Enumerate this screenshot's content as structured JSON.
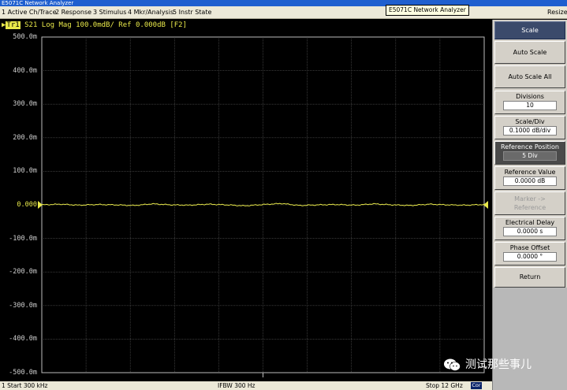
{
  "window": {
    "title": "E5071C Network Analyzer",
    "tooltip": "E5071C Network Analyzer",
    "resize_label": "Resize"
  },
  "menu": {
    "items": [
      "1 Active Ch/Trace",
      "2 Response",
      "3 Stimulus",
      "4 Mkr/Analysis",
      "5 Instr State"
    ]
  },
  "trace": {
    "id": "Tr1",
    "header": " S21 Log Mag 100.0mdB/ Ref 0.000dB [F2]",
    "color": "#e8e84a"
  },
  "axis": {
    "y_labels": [
      "500.0m",
      "400.0m",
      "300.0m",
      "200.0m",
      "100.0m",
      "0.000",
      "-100.0m",
      "-200.0m",
      "-300.0m",
      "-400.0m",
      "-500.0m"
    ],
    "divisions": 10,
    "ref_label": "0.000"
  },
  "chart_data": {
    "type": "line",
    "y_range": [
      -0.5,
      0.5
    ],
    "ylim": [
      -0.5,
      0.5
    ],
    "series": [
      {
        "values": [
          0.0,
          0.002,
          -0.001,
          0.001,
          0.0,
          -0.002,
          0.003,
          0.0,
          -0.001,
          0.002,
          0.0,
          -0.003,
          0.001,
          0.004,
          -0.002,
          0.0,
          0.001,
          -0.001,
          0.003,
          0.0,
          -0.002,
          0.002,
          0.0,
          -0.001,
          0.001
        ]
      }
    ]
  },
  "status": {
    "start": "1  Start 300 kHz",
    "ifbw": "IFBW 300 Hz",
    "stop": "Stop 12 GHz",
    "cor": "Cor"
  },
  "softkeys": {
    "title": "Scale",
    "auto_scale": "Auto Scale",
    "auto_scale_all": "Auto Scale All",
    "divisions_label": "Divisions",
    "divisions_value": "10",
    "scale_div_label": "Scale/Div",
    "scale_div_value": "0.1000 dB/div",
    "ref_pos_label": "Reference Position",
    "ref_pos_value": "5 Div",
    "ref_value_label": "Reference Value",
    "ref_value_value": "0.0000 dB",
    "marker_ref_label1": "Marker ->",
    "marker_ref_label2": "Reference",
    "elec_delay_label": "Electrical Delay",
    "elec_delay_value": "0.0000 s",
    "phase_offset_label": "Phase Offset",
    "phase_offset_value": "0.0000 °",
    "return": "Return"
  },
  "watermark": {
    "text": "测试那些事儿"
  }
}
